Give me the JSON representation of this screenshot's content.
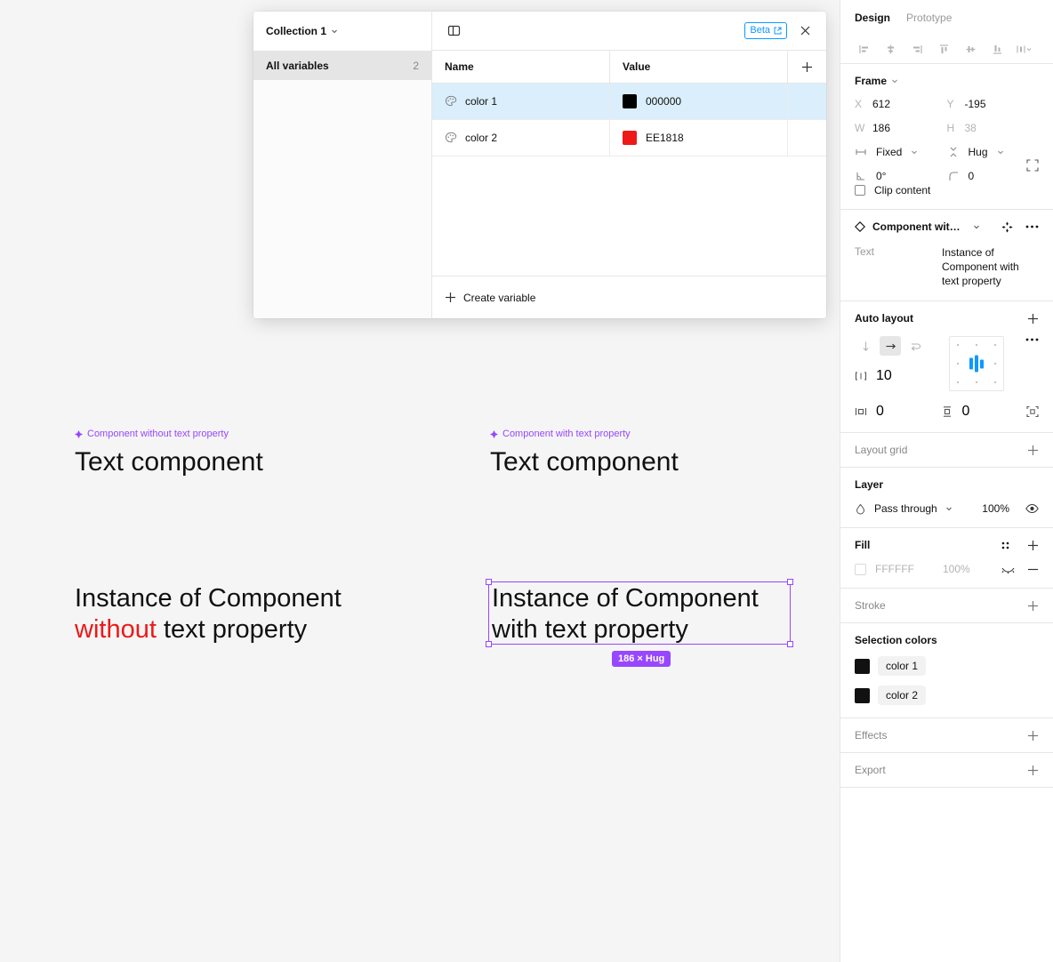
{
  "canvas": {
    "background": "#f5f5f5",
    "component_groups": [
      {
        "badge": "Component without text property",
        "heading": "Text component"
      },
      {
        "badge": "Component with text property",
        "heading": "Text component"
      }
    ],
    "instances": [
      {
        "line1": "Instance of Component",
        "line2_accent": "without",
        "line2_rest": " text property"
      },
      {
        "line1": "Instance of Component",
        "line2": "with text property"
      }
    ],
    "selection_badge": "186 × Hug",
    "accent_purple": "#9747ff",
    "accent_red": "#EE1818"
  },
  "variables_modal": {
    "collection_name": "Collection 1",
    "sidebar_item_label": "All variables",
    "sidebar_item_count": "2",
    "beta_label": "Beta",
    "columns": {
      "name": "Name",
      "value": "Value"
    },
    "rows": [
      {
        "name": "color 1",
        "value": "000000",
        "swatch": "#000000",
        "selected": true
      },
      {
        "name": "color 2",
        "value": "EE1818",
        "swatch": "#EE1818",
        "selected": false
      }
    ],
    "create_variable_label": "Create variable",
    "icons": {
      "panel_toggle": "panel-toggle-icon",
      "close": "close-icon",
      "add_variable": "plus-icon",
      "row_type": "palette-icon"
    }
  },
  "right_panel": {
    "tabs": {
      "design": "Design",
      "prototype": "Prototype"
    },
    "frame": {
      "title": "Frame",
      "x_label": "X",
      "x_value": "612",
      "y_label": "Y",
      "y_value": "-195",
      "w_label": "W",
      "w_value": "186",
      "h_label": "H",
      "h_value": "38",
      "horizontal_resizing": "Fixed",
      "vertical_resizing": "Hug",
      "rotation": "0°",
      "corner_radius": "0",
      "clip_content": "Clip content"
    },
    "component": {
      "title": "Component with t...",
      "prop_key": "Text",
      "prop_value": "Instance of Component with text property"
    },
    "auto_layout": {
      "title": "Auto layout",
      "gap": "10",
      "padding_horizontal": "0",
      "padding_vertical": "0"
    },
    "layout_grid": {
      "title": "Layout grid"
    },
    "layer": {
      "title": "Layer",
      "blend_mode": "Pass through",
      "opacity": "100%"
    },
    "fill": {
      "title": "Fill",
      "hex": "FFFFFF",
      "opacity": "100%"
    },
    "stroke": {
      "title": "Stroke"
    },
    "selection_colors": {
      "title": "Selection colors",
      "items": [
        {
          "label": "color 1",
          "swatch": "#111111"
        },
        {
          "label": "color 2",
          "swatch": "#111111"
        }
      ]
    },
    "effects": {
      "title": "Effects"
    },
    "export": {
      "title": "Export"
    }
  }
}
